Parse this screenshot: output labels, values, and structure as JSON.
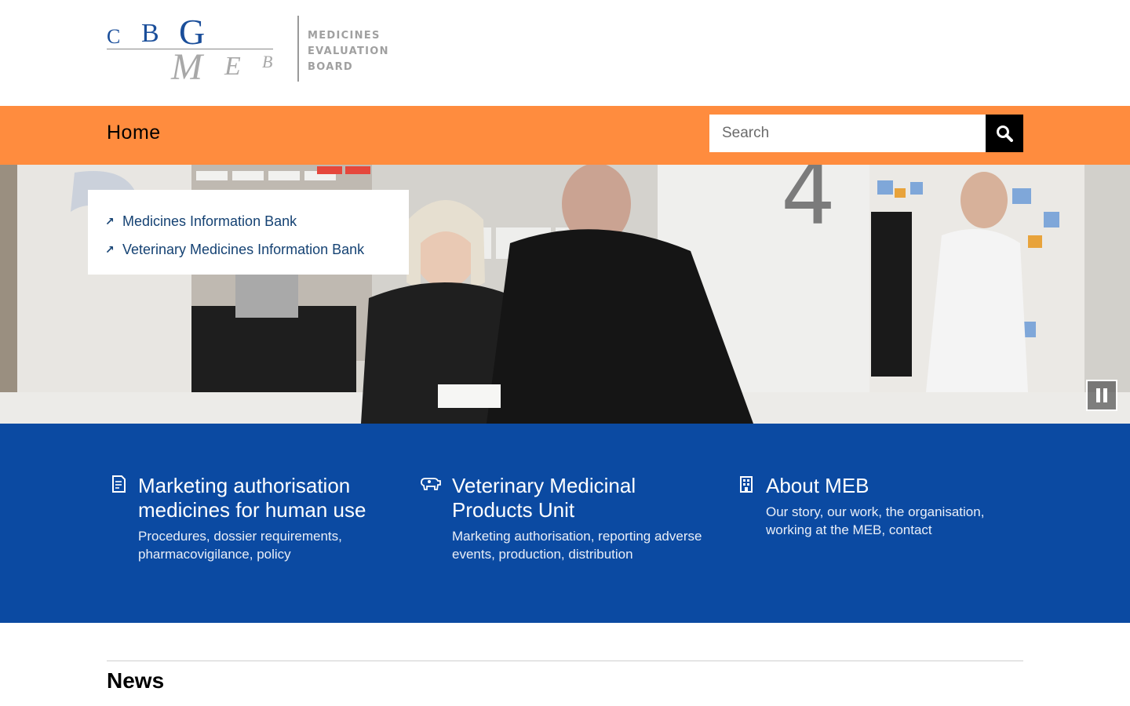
{
  "logo": {
    "letters_top": [
      "C",
      "B",
      "G"
    ],
    "letters_bottom": [
      "M",
      "E",
      "B"
    ],
    "text_lines": [
      "MEDICINES",
      "EVALUATION",
      "BOARD"
    ],
    "brand_color": "#1a4e9a",
    "muted_color": "#a8a8a8"
  },
  "nav": {
    "home_label": "Home",
    "background_color": "#ff8c3e"
  },
  "search": {
    "placeholder": "Search",
    "value": "",
    "button_icon": "magnifier-icon"
  },
  "hero": {
    "quick_links": [
      {
        "label": "Medicines Information Bank",
        "icon": "external-arrow-icon"
      },
      {
        "label": "Veterinary Medicines Information Bank",
        "icon": "external-arrow-icon"
      }
    ],
    "pause_icon": "pause-icon"
  },
  "tiles": [
    {
      "icon": "document-icon",
      "title": "Marketing authorisation medicines for human use",
      "description": "Procedures, dossier requirements, pharmacovigilance, policy"
    },
    {
      "icon": "animals-icon",
      "title": "Veterinary Medicinal Products Unit",
      "description": "Marketing authorisation, reporting adverse events, production, distribution"
    },
    {
      "icon": "building-icon",
      "title": "About MEB",
      "description": "Our story, our work, the organisation, working at the MEB, contact"
    }
  ],
  "band_color": "#0b4aa2",
  "news": {
    "heading": "News"
  }
}
